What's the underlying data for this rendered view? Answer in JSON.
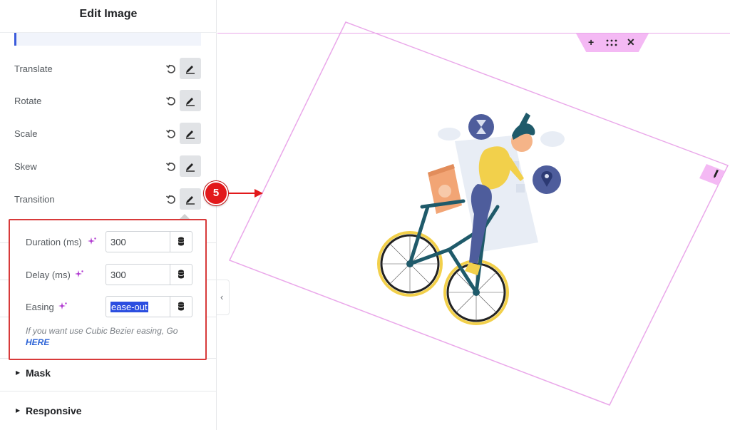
{
  "panel": {
    "title": "Edit Image",
    "rows": [
      {
        "label": "Translate"
      },
      {
        "label": "Rotate"
      },
      {
        "label": "Scale"
      },
      {
        "label": "Skew"
      },
      {
        "label": "Transition"
      }
    ]
  },
  "transition_popover": {
    "duration": {
      "label": "Duration (ms)",
      "value": "300"
    },
    "delay": {
      "label": "Delay (ms)",
      "value": "300"
    },
    "easing": {
      "label": "Easing",
      "value": "ease-out"
    },
    "note": "If you want use Cubic Bezier easing, Go",
    "note_link": "HERE"
  },
  "sections": [
    {
      "label": "Mask"
    },
    {
      "label": "Responsive"
    }
  ],
  "callout": {
    "number": "5"
  },
  "colors": {
    "accent_red": "#e2191b",
    "highlight_border": "#d83a3a",
    "guide_pink": "#eaa8ea",
    "toolbar_pink": "#f4b9f4",
    "selection_blue": "#2b4ee0"
  },
  "icons": {
    "reset": "reset-icon",
    "edit": "pencil-icon",
    "dynamic": "database-icon",
    "ai": "sparkle-icon",
    "add": "plus-icon",
    "move": "drag-handle-icon",
    "close": "close-icon"
  }
}
